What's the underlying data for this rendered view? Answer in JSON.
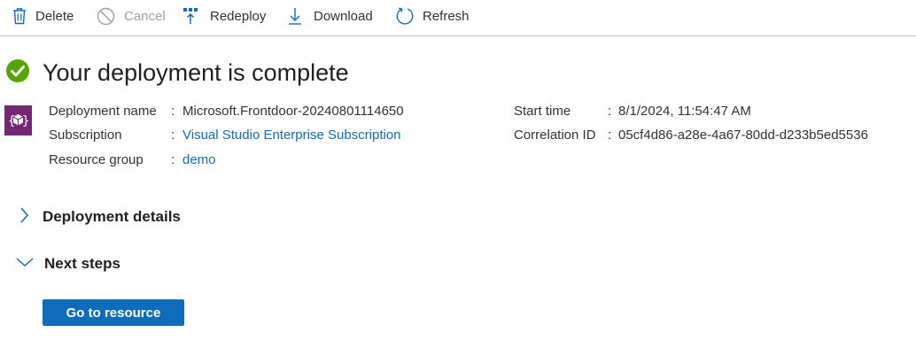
{
  "toolbar": {
    "delete_label": "Delete",
    "cancel_label": "Cancel",
    "redeploy_label": "Redeploy",
    "download_label": "Download",
    "refresh_label": "Refresh"
  },
  "page": {
    "title": "Your deployment is complete"
  },
  "details": {
    "deployment_name_label": "Deployment name",
    "deployment_name_value": "Microsoft.Frontdoor-20240801114650",
    "subscription_label": "Subscription",
    "subscription_value": "Visual Studio Enterprise Subscription",
    "resource_group_label": "Resource group",
    "resource_group_value": "demo",
    "start_time_label": "Start time",
    "start_time_value": "8/1/2024, 11:54:47 AM",
    "correlation_id_label": "Correlation ID",
    "correlation_id_value": "05cf4d86-a28e-4a67-80dd-d233b5ed5536",
    "separator": ":"
  },
  "sections": {
    "deployment_details_label": "Deployment details",
    "next_steps_label": "Next steps"
  },
  "actions": {
    "go_to_resource_label": "Go to resource"
  },
  "colors": {
    "success": "#57a300",
    "accent": "#0f6cbd",
    "resource_icon": "#742774"
  },
  "icons": {
    "delete": "trash-icon",
    "cancel": "cancel-icon",
    "redeploy": "redeploy-icon",
    "download": "download-icon",
    "refresh": "refresh-icon",
    "status": "success-check-icon",
    "resource": "deployment-resource-icon",
    "expand": "chevron-right-icon",
    "collapse": "chevron-down-icon"
  }
}
